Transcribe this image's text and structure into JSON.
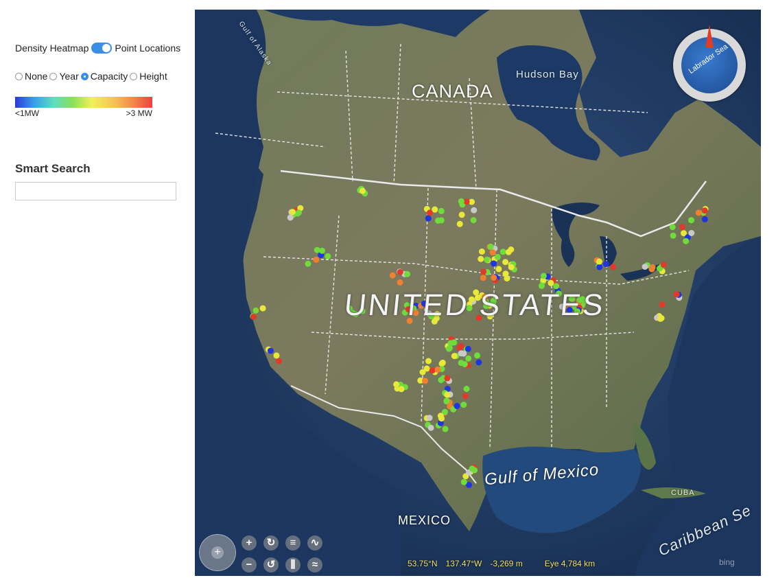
{
  "panel": {
    "toggle_left": "Density Heatmap",
    "toggle_right": "Point Locations",
    "radio_options": [
      "None",
      "Year",
      "Capacity",
      "Height"
    ],
    "radio_selected": "Capacity",
    "legend_min": "<1MW",
    "legend_max": ">3 MW",
    "search_title": "Smart Search",
    "search_value": ""
  },
  "map": {
    "labels": {
      "canada": "CANADA",
      "us": "UNITED STATES",
      "hudson": "Hudson Bay",
      "gulf": "Gulf of Mexico",
      "mexico": "MEXICO",
      "cuba": "CUBA",
      "caribbean": "Caribbean Se",
      "alaska": "Gulf of Alaska",
      "compass": "Labrador Sea"
    },
    "status": {
      "lat": "53.75°N",
      "lon": "137.47°W",
      "alt": "-3,269 m",
      "eye": "Eye  4,784 km"
    },
    "attribution": "bing",
    "colors": {
      "lt1": "#1f35e0",
      "low": "#6fdc3c",
      "mid": "#e8e83a",
      "high": "#f07f30",
      "gt3": "#e23a2a",
      "none": "#c9c9c9"
    }
  }
}
